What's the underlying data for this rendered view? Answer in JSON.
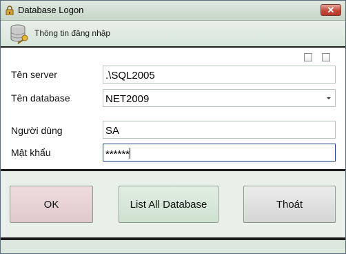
{
  "window": {
    "title": "Database Logon",
    "close_glyph": "✕"
  },
  "header": {
    "title": "Thông tin đăng nhập",
    "icon": "database-key-icon"
  },
  "form": {
    "server_label": "Tên server",
    "server_value": ".\\SQL2005",
    "database_label": "Tên database",
    "database_value": "NET2009",
    "user_label": "Người dùng",
    "user_value": "SA",
    "password_label": "Mật khẩu",
    "password_value": "******"
  },
  "buttons": {
    "ok": "OK",
    "list_all": "List All Database",
    "exit": "Thoát"
  },
  "colors": {
    "window_bg": "#e6eee7",
    "close_button": "#c44a3c",
    "focus_border": "#1f3d78"
  }
}
